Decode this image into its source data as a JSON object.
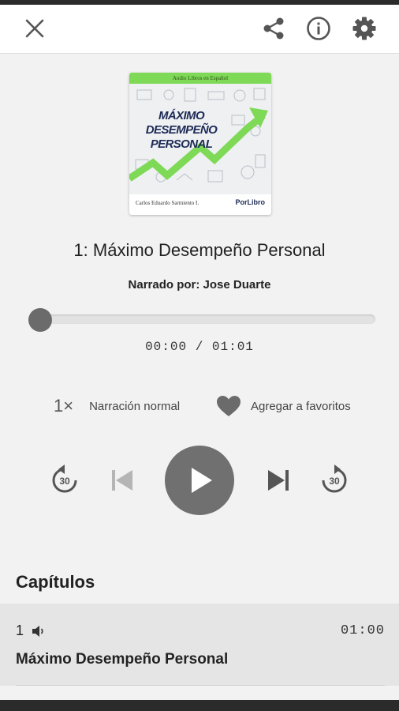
{
  "header": {
    "close_icon": "close-icon",
    "share_icon": "share-icon",
    "info_icon": "info-icon",
    "settings_icon": "gear-icon"
  },
  "cover": {
    "banner": "Audio Libros en Español",
    "title_line1": "MÁXIMO DESEMPEÑO",
    "title_line2": "PERSONAL",
    "author": "Carlos Eduardo Sarmiento I.",
    "publisher": "PorLibro"
  },
  "track": {
    "title": "1: Máximo Desempeño Personal",
    "narrator": "Narrado por: Jose Duarte",
    "time": "00:00 / 01:01",
    "progress": 0.03
  },
  "options": {
    "speed": "1×",
    "speed_label": "Narración normal",
    "favorite_label": "Agregar a favoritos"
  },
  "controls": {
    "rewind_seconds": "30",
    "forward_seconds": "30"
  },
  "chapters": {
    "heading": "Capítulos",
    "items": [
      {
        "number": "1",
        "duration": "01:00",
        "title": "Máximo Desempeño Personal"
      }
    ]
  },
  "colors": {
    "accent_green": "#7ed957",
    "control_gray": "#707070",
    "header_icon": "#555555"
  }
}
